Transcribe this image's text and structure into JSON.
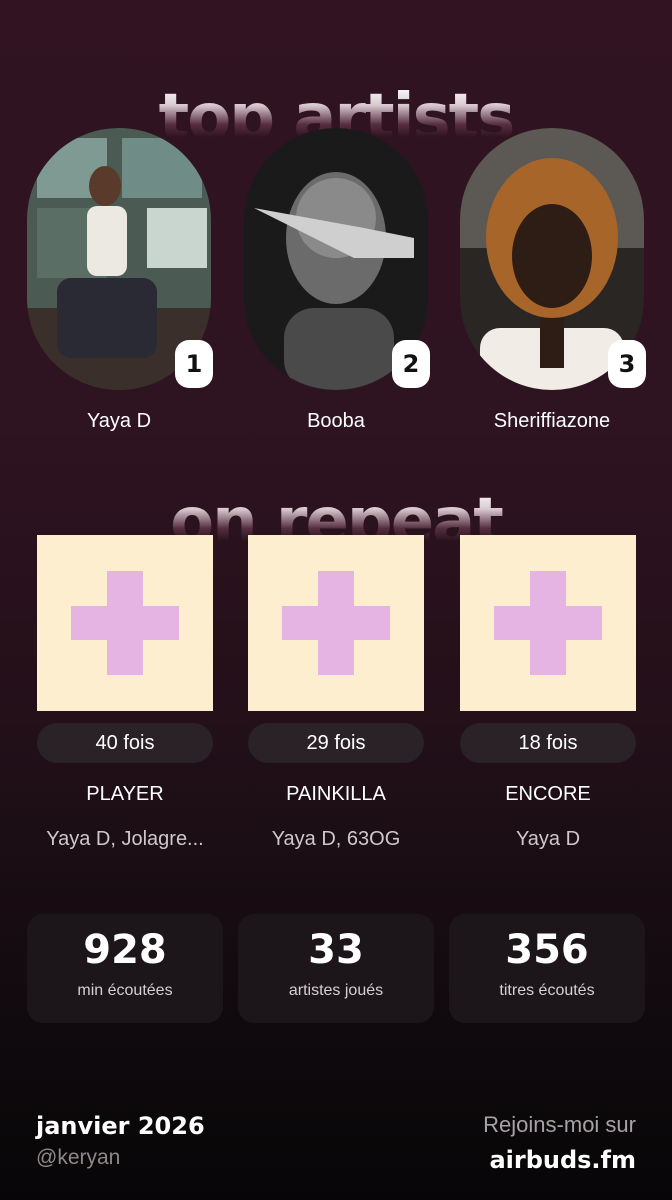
{
  "sections": {
    "top_artists_title": "top artists",
    "on_repeat_title": "on repeat"
  },
  "artists": [
    {
      "rank": "1",
      "name": "Yaya D"
    },
    {
      "rank": "2",
      "name": "Booba"
    },
    {
      "rank": "3",
      "name": "Sheriffiazone"
    }
  ],
  "tracks": [
    {
      "plays": "40 fois",
      "title": "PLAYER",
      "artists": "Yaya D, Jolagre..."
    },
    {
      "plays": "29 fois",
      "title": "PAINKILLA",
      "artists": "Yaya D, 63OG"
    },
    {
      "plays": "18 fois",
      "title": "ENCORE",
      "artists": "Yaya D"
    }
  ],
  "stats": [
    {
      "value": "928",
      "label": "min écoutées"
    },
    {
      "value": "33",
      "label": "artistes joués"
    },
    {
      "value": "356",
      "label": "titres écoutés"
    }
  ],
  "footer": {
    "date": "janvier 2026",
    "handle": "@keryan",
    "cta": "Rejoins-moi sur",
    "brand": "airbuds.fm"
  },
  "colors": {
    "cover_bg": "#fdeed0",
    "plus": "#e5b4e3",
    "card_bg": "#1c1519",
    "pill_bg": "#2b2228"
  }
}
